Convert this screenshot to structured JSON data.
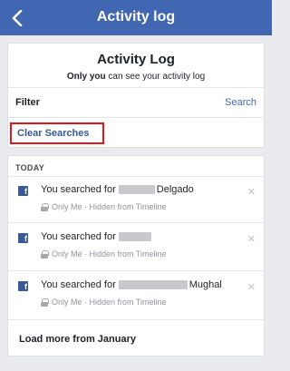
{
  "header": {
    "title": "Activity log",
    "back_icon": "chevron-left-icon"
  },
  "summary": {
    "title": "Activity Log",
    "subtitle_bold": "Only you",
    "subtitle_rest": " can see your activity log",
    "filter_label": "Filter",
    "search_label": "Search",
    "clear_searches_label": "Clear Searches"
  },
  "feed": {
    "heading": "TODAY",
    "items": [
      {
        "text_prefix": "You searched for",
        "text_suffix": "Delgado",
        "meta": "Only Me · Hidden from Timeline"
      },
      {
        "text_prefix": "You searched for",
        "text_suffix": "",
        "meta": "Only Me · Hidden from Timeline"
      },
      {
        "text_prefix": "You searched for",
        "text_suffix": "Mughal",
        "meta": "Only Me · Hidden from Timeline"
      }
    ],
    "load_more_label": "Load more from January"
  },
  "colors": {
    "brand": "#4267b2",
    "highlight": "#e8141c",
    "link": "#365899"
  }
}
